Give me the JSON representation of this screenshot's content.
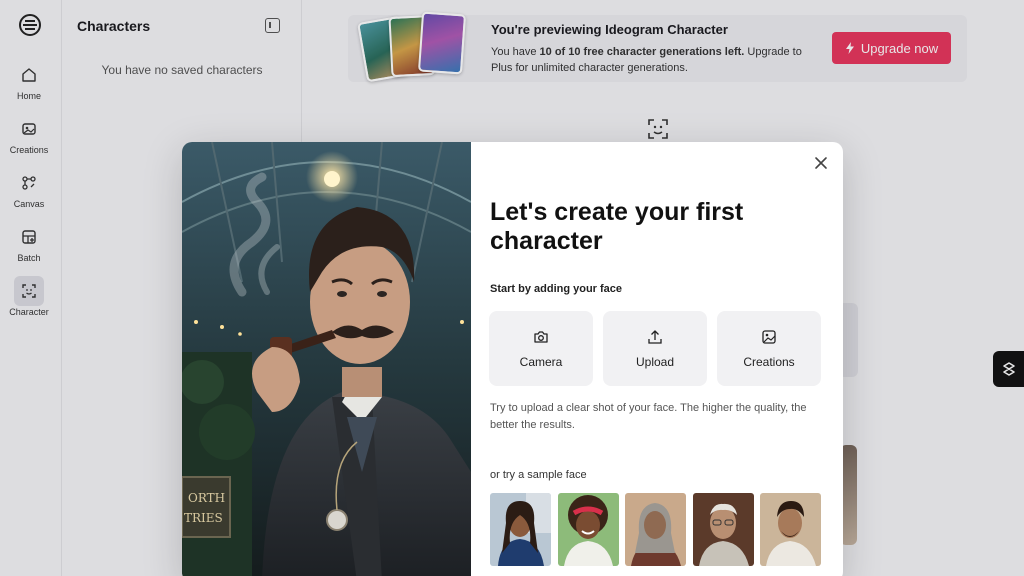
{
  "rail": {
    "items": [
      {
        "label": "Home",
        "icon": "home-icon"
      },
      {
        "label": "Creations",
        "icon": "image-icon"
      },
      {
        "label": "Canvas",
        "icon": "canvas-icon"
      },
      {
        "label": "Batch",
        "icon": "batch-icon"
      },
      {
        "label": "Character",
        "icon": "character-icon"
      }
    ],
    "active": "Character"
  },
  "panel": {
    "title": "Characters",
    "empty_text": "You have no saved characters"
  },
  "banner": {
    "title": "You're previewing Ideogram Character",
    "text_prefix": "You have ",
    "text_bold": "10 of 10 free character generations left.",
    "text_suffix": " Upgrade to Plus for unlimited character generations.",
    "upgrade_label": "Upgrade now",
    "accent": "#e8365d"
  },
  "modal": {
    "title": "Let's create your first character",
    "subtitle": "Start by adding your face",
    "options": [
      {
        "label": "Camera",
        "icon": "camera-icon"
      },
      {
        "label": "Upload",
        "icon": "upload-icon"
      },
      {
        "label": "Creations",
        "icon": "image-icon"
      }
    ],
    "hint": "Try to upload a clear shot of your face. The higher the quality, the better the results.",
    "sample_label": "or try a sample face",
    "hero_sign_line1": "ORTH",
    "hero_sign_line2": "TRIES"
  }
}
